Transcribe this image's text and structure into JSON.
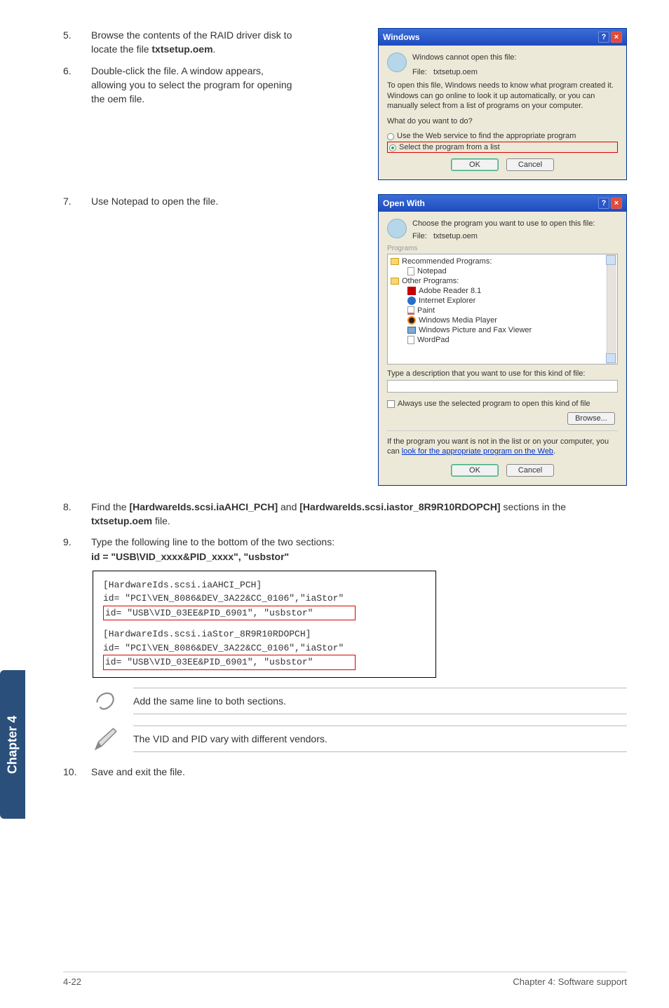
{
  "steps": {
    "s5": {
      "num": "5.",
      "text_pre": "Browse the contents of the RAID driver disk to locate the file ",
      "bold": "txtsetup.oem",
      "text_post": "."
    },
    "s6": {
      "num": "6.",
      "text": "Double-click the file. A window appears, allowing you to select the program for opening the oem file."
    },
    "s7": {
      "num": "7.",
      "text": "Use Notepad to open the file."
    },
    "s8": {
      "num": "8.",
      "pre": "Find the ",
      "b1": "[HardwareIds.scsi.iaAHCI_PCH]",
      "mid": " and ",
      "b2": "[HardwareIds.scsi.iastor_8R9R10RDOPCH]",
      "mid2": " sections in the ",
      "b3": "txtsetup.oem",
      "post": " file."
    },
    "s9": {
      "num": "9.",
      "pre": "Type the following line to the bottom of the two sections:",
      "bold": "id = \"USB\\VID_xxxx&PID_xxxx\", \"usbstor\""
    },
    "s10": {
      "num": "10.",
      "text": "Save and exit the file."
    }
  },
  "windows_dialog": {
    "title": "Windows",
    "cannot_open": "Windows cannot open this file:",
    "file_label": "File:",
    "file_name": "txtsetup.oem",
    "explain": "To open this file, Windows needs to know what program created it.  Windows can go online to look it up automatically, or you can manually select from a list of programs on your computer.",
    "what_do": "What do you want to do?",
    "opt_web": "Use the Web service to find the appropriate program",
    "opt_list": "Select the program from a list",
    "ok": "OK",
    "cancel": "Cancel"
  },
  "openwith_dialog": {
    "title": "Open With",
    "choose": "Choose the program you want to use to open this file:",
    "file_label": "File:",
    "file_name": "txtsetup.oem",
    "programs_label": "Programs",
    "rec_label": "Recommended Programs:",
    "notepad": "Notepad",
    "other_label": "Other Programs:",
    "adobe": "Adobe Reader 8.1",
    "ie": "Internet Explorer",
    "paint": "Paint",
    "wmp": "Windows Media Player",
    "picfax": "Windows Picture and Fax Viewer",
    "wordpad": "WordPad",
    "desc_label": "Type a description that you want to use for this kind of file:",
    "always": "Always use the selected program to open this kind of file",
    "browse": "Browse...",
    "not_in_list_pre": "If the program you want is not in the list or on your computer, you can ",
    "not_in_list_link1": "look for the appropriate program on the Web",
    "not_in_list_post": ".",
    "ok": "OK",
    "cancel": "Cancel"
  },
  "code": {
    "l1": "[HardwareIds.scsi.iaAHCI_PCH]",
    "l2": "id= \"PCI\\VEN_8086&DEV_3A22&CC_0106\",\"iaStor\"",
    "l3": "id= \"USB\\VID_03EE&PID_6901\", \"usbstor\"",
    "l4": "[HardwareIds.scsi.iaStor_8R9R10RDOPCH]",
    "l5": "id= \"PCI\\VEN_8086&DEV_3A22&CC_0106\",\"iaStor\"",
    "l6": "id= \"USB\\VID_03EE&PID_6901\", \"usbstor\""
  },
  "notes": {
    "note1": "Add the same line to both sections.",
    "note2": "The VID and PID vary with different vendors."
  },
  "chapter_tab": "Chapter 4",
  "footer": {
    "left": "4-22",
    "right": "Chapter 4: Software support"
  }
}
